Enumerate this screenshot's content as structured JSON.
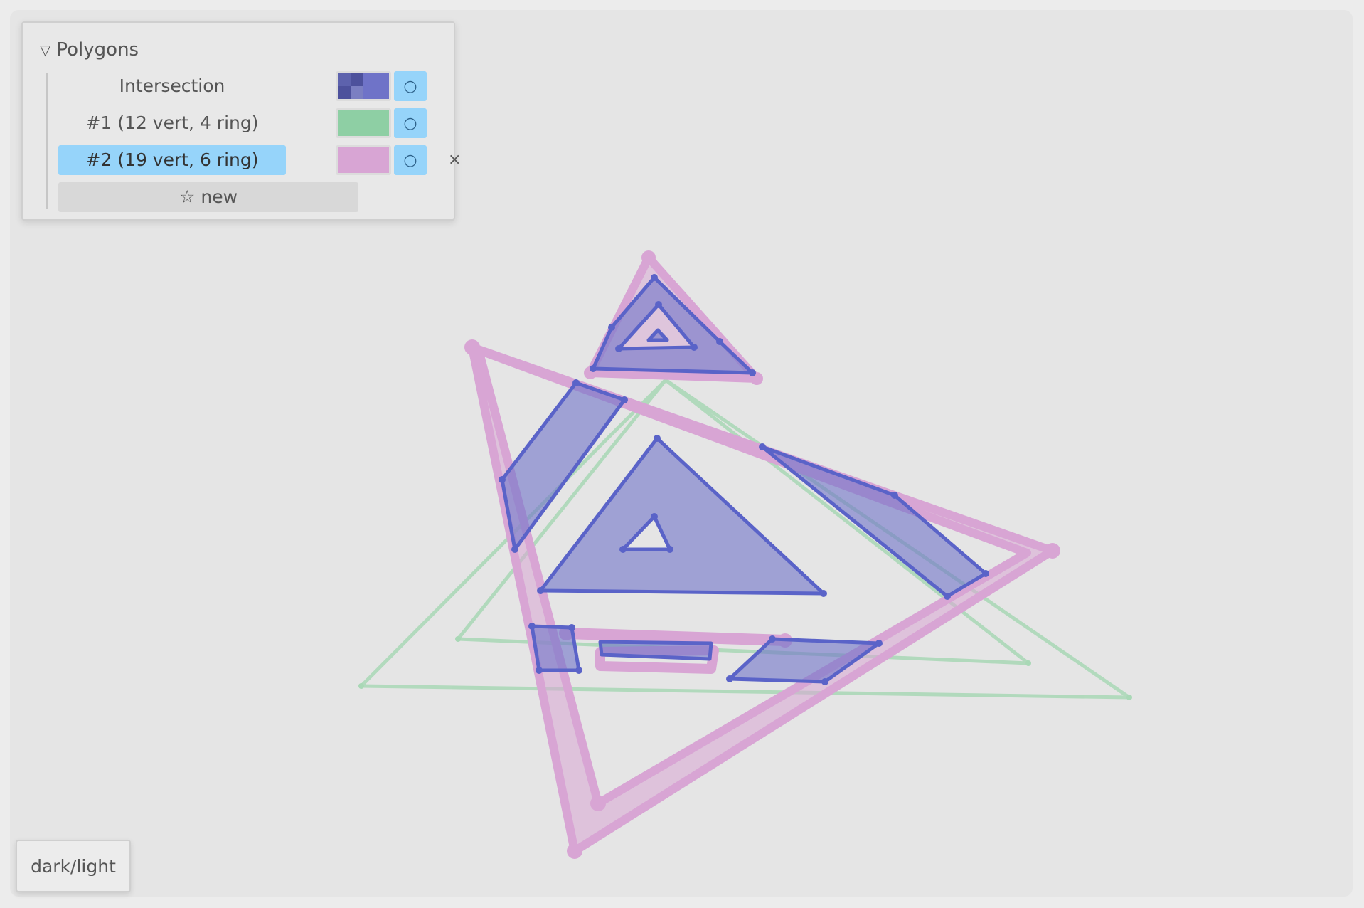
{
  "panel": {
    "title": "Polygons",
    "collapse_glyph": "▽",
    "rows": [
      {
        "label": "Intersection",
        "color": "#6f73c8",
        "toggle_glyph": "○"
      },
      {
        "label": "#1 (12 vert, 4 ring)",
        "color": "#8ecfa4",
        "toggle_glyph": "○"
      },
      {
        "label": "#2 (19 vert, 6 ring)",
        "color": "#d8a5d4",
        "toggle_glyph": "○",
        "selected": true,
        "close_glyph": "×"
      }
    ],
    "new_label": "☆ new"
  },
  "theme_toggle_label": "dark/light",
  "colors": {
    "accent": "#96d4fa",
    "polygon1_green": "#8ecfa4",
    "polygon2_pink": "#d8a5d4",
    "intersection_blue": "#6f73c8"
  },
  "icons": [
    "collapse-triangle-icon",
    "circle-toggle-icon",
    "close-icon",
    "star-icon"
  ]
}
